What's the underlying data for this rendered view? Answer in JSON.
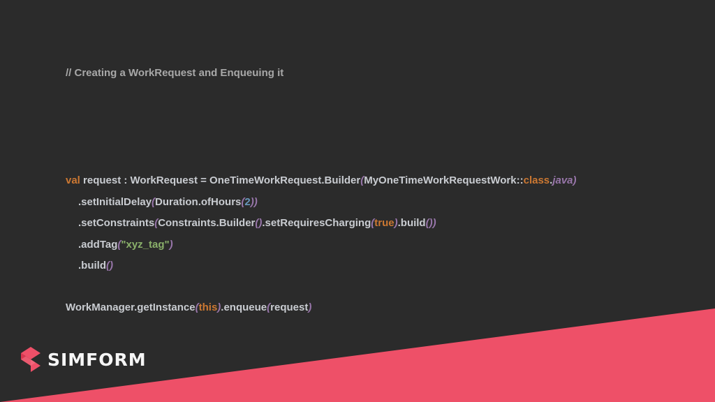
{
  "slide": {
    "comment": "// Creating a WorkRequest and Enqueuing it",
    "colors": {
      "background": "#2b2b2b",
      "accent": "#ee5068",
      "keyword": "#cc7832",
      "paren": "#9876aa",
      "string": "#8ab06a",
      "number": "#6897bb",
      "text": "#c9ccd1"
    },
    "code": {
      "line1": {
        "kw_val": "val",
        "t1": " request : WorkRequest = OneTimeWorkRequest.Builder",
        "p1": "(",
        "t2": "MyOneTimeWorkRequestWork::",
        "kw_class": "class",
        "t3": ".",
        "java": "java",
        "p2": ")"
      },
      "line2": {
        "t1": ".setInitialDelay",
        "p1": "(",
        "t2": "Duration.ofHours",
        "p2": "(",
        "num": "2",
        "p3": "))"
      },
      "line3": {
        "t1": ".setConstraints",
        "p1": "(",
        "t2": "Constraints.Builder",
        "p2": "()",
        "t3": ".setRequiresCharging",
        "p3": "(",
        "kw_true": "true",
        "p4": ")",
        "t4": ".build",
        "p5": "())"
      },
      "line4": {
        "t1": ".addTag",
        "p1": "(",
        "str": "\"xyz_tag\"",
        "p2": ")"
      },
      "line5": {
        "t1": ".build",
        "p1": "()"
      },
      "line6": {
        "t1": "WorkManager.getInstance",
        "p1": "(",
        "kw_this": "this",
        "p2": ")",
        "t2": ".enqueue",
        "p3": "(",
        "t3": "request",
        "p4": ")"
      }
    },
    "logo": {
      "text": "SIMFORM",
      "icon": "simform-s-logo-icon"
    }
  }
}
